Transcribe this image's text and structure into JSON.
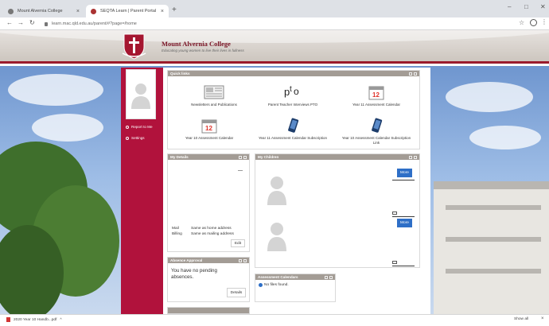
{
  "browser": {
    "tabs": [
      {
        "title": "Mount Alvernia College",
        "active": false
      },
      {
        "title": "SEQTA Learn | Parent Portal",
        "active": true
      }
    ],
    "new_tab": "+",
    "tab_close": "×",
    "url": "learn.mac.qld.edu.au/parent/#?page=/home",
    "window_controls": {
      "minimize": "–",
      "maximize": "□",
      "close": "✕"
    },
    "nav": {
      "back": "←",
      "forward": "→",
      "reload": "↻"
    },
    "star": "☆",
    "menu": "⋮"
  },
  "header": {
    "school_name": "Mount Alvernia College",
    "motto": "Educating young women to live their lives in fullness"
  },
  "sidebar": {
    "links": [
      {
        "label": "Report to Me"
      },
      {
        "label": "Settings"
      }
    ]
  },
  "quick_links": {
    "title": "Quick links",
    "items": [
      {
        "label": "Newsletters and Publications",
        "icon": "newspaper-icon"
      },
      {
        "label": "Parent Teacher Interviews PTO",
        "icon": "pto-icon"
      },
      {
        "label": "Year 11 Assessment Calendar",
        "icon": "calendar-icon"
      },
      {
        "label": "Year 10 Assessment Calendar",
        "icon": "calendar-icon"
      },
      {
        "label": "Year 11 Assessment Calendar Subscription",
        "icon": "phone-icon"
      },
      {
        "label": "Year 10 Assessment Calendar Subscription Link",
        "icon": "phone-icon"
      }
    ]
  },
  "my_details": {
    "title": "My Details",
    "rows": [
      {
        "key": "Mail",
        "value": "Same as home address"
      },
      {
        "key": "Billing",
        "value": "Same as mailing address"
      }
    ],
    "edit_label": "Edit"
  },
  "my_children": {
    "title": "My Children",
    "more_label": "More"
  },
  "absence_approval": {
    "title": "Absence Approval",
    "message": "You have no pending absences.",
    "details_label": "Details"
  },
  "assessment_calendars": {
    "title": "Assessment Calendars",
    "message": "No files found."
  },
  "downloads": {
    "file": "2020 Year 10 Handb...pdf",
    "caret": "^",
    "show_all": "Show all",
    "close": "×"
  },
  "colors": {
    "brand": "#b1123c",
    "widget_header": "#a39c95",
    "button": "#2e6fc7"
  }
}
